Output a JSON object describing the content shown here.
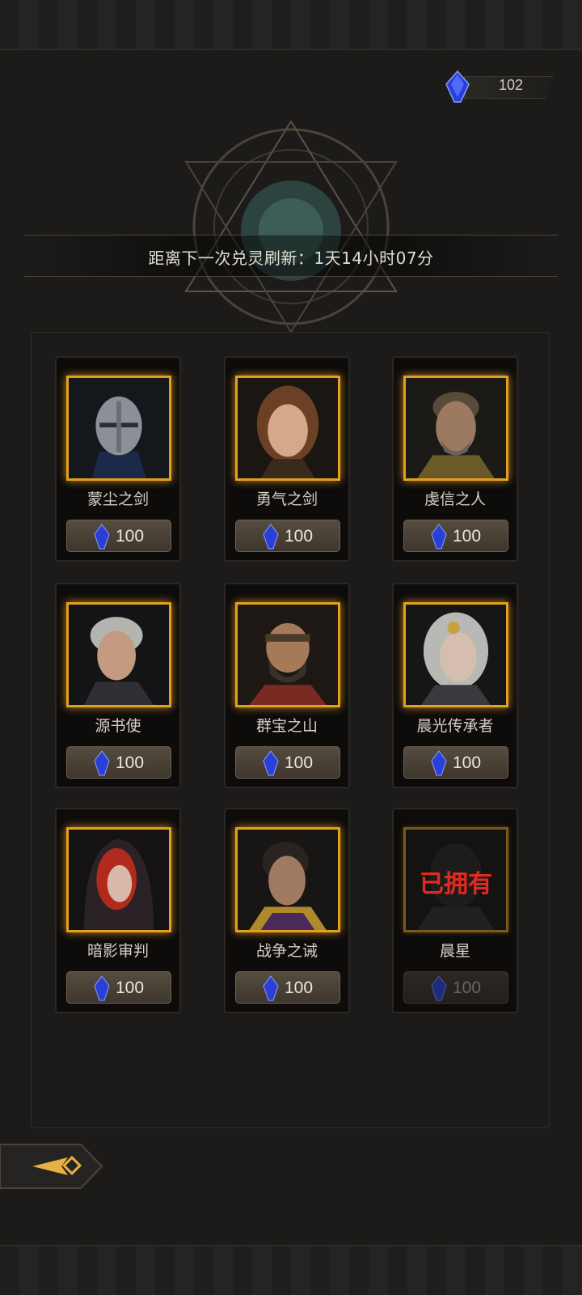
{
  "currency": {
    "icon": "blue-crystal-icon",
    "value": "102"
  },
  "refresh": {
    "text": "距离下一次兑灵刷新：1天14小时07分"
  },
  "colors": {
    "accent_gold": "#e3a01e",
    "owned_red": "#e02a20",
    "crystal_blue": "#2a3fd6"
  },
  "cards": [
    {
      "name": "蒙尘之剑",
      "price": "100",
      "portrait": "armored-knight-helmet",
      "owned": false
    },
    {
      "name": "勇气之剑",
      "price": "100",
      "portrait": "young-woman-brown-hair",
      "owned": false
    },
    {
      "name": "虔信之人",
      "price": "100",
      "portrait": "bearded-man-armor",
      "owned": false
    },
    {
      "name": "源书使",
      "price": "100",
      "portrait": "silver-haired-youth",
      "owned": false
    },
    {
      "name": "群宝之山",
      "price": "100",
      "portrait": "bearded-man-headband",
      "owned": false
    },
    {
      "name": "晨光传承者",
      "price": "100",
      "portrait": "white-haired-woman-crown",
      "owned": false
    },
    {
      "name": "暗影审判",
      "price": "100",
      "portrait": "red-haired-hooded-woman",
      "owned": false
    },
    {
      "name": "战争之诫",
      "price": "100",
      "portrait": "dark-haired-warrior",
      "owned": false
    },
    {
      "name": "晨星",
      "price": "100",
      "portrait": "hidden-figure",
      "owned": true,
      "owned_label": "已拥有"
    }
  ],
  "back_button": {
    "icon": "back-arrow-icon"
  }
}
